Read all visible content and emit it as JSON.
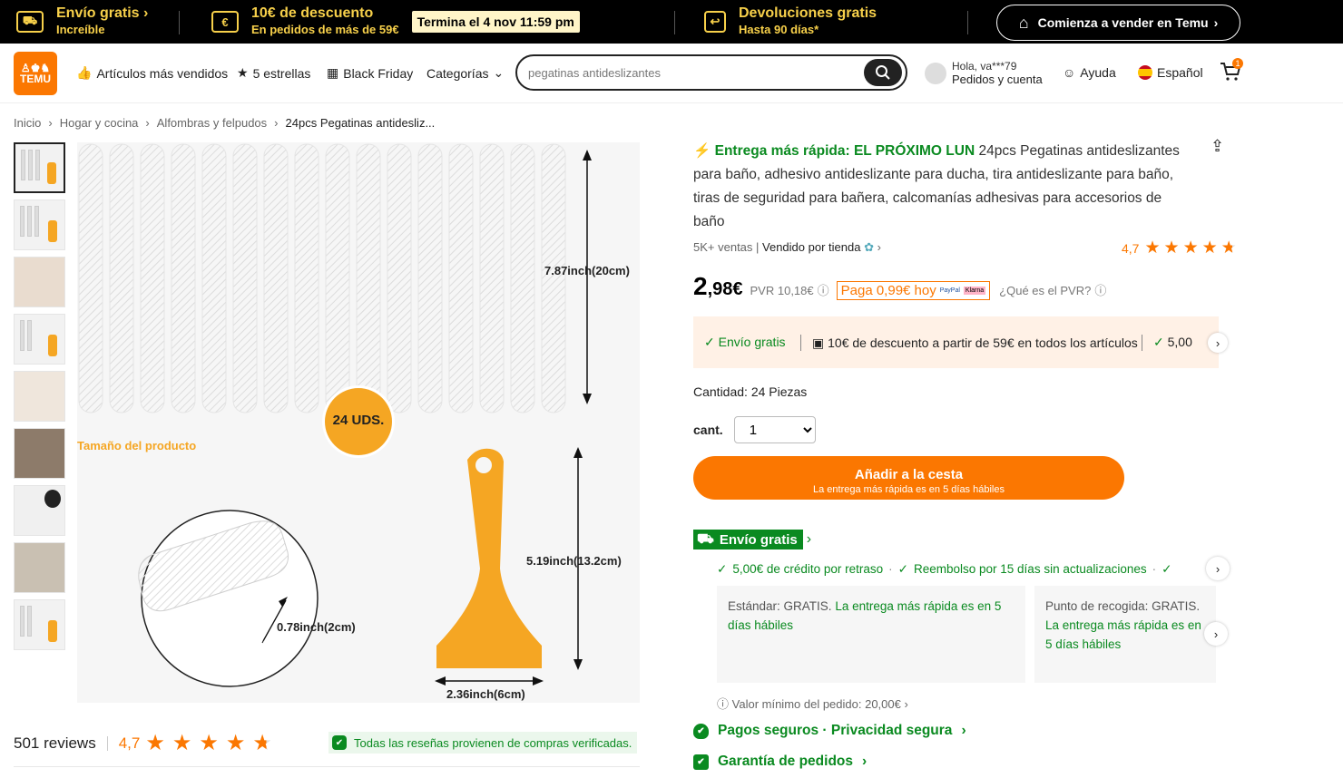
{
  "topbar": {
    "free_shipping_title": "Envío gratis",
    "free_shipping_sub": "Increíble",
    "discount_title": "10€ de descuento",
    "discount_sub": "En pedidos de más de 59€",
    "timer": "Termina el 4 nov 11:59 pm",
    "returns_title": "Devoluciones gratis",
    "returns_sub": "Hasta 90 días*",
    "sell_label": "Comienza a vender en Temu"
  },
  "nav": {
    "logo": "TEMU",
    "links": [
      "Artículos más vendidos",
      "5 estrellas",
      "Black Friday",
      "Categorías"
    ],
    "search_value": "pegatinas antideslizantes",
    "greeting": "Hola, va***79",
    "account": "Pedidos y cuenta",
    "help": "Ayuda",
    "language": "Español",
    "cart_count": "1"
  },
  "breadcrumb": [
    "Inicio",
    "Hogar y cocina",
    "Alfombras y felpudos",
    "24pcs Pegatinas antidesliz..."
  ],
  "image": {
    "dim_strip": "7.87inch(20cm)",
    "dim_handle": "5.19inch(13.2cm)",
    "dim_width": "2.36inch(6cm)",
    "dim_circle": "0.78inch(2cm)",
    "count_badge": "24 UDS.",
    "size_label": "Tamaño del producto"
  },
  "reviews": {
    "count": "501 reviews",
    "rating": "4,7",
    "verified": "Todas las reseñas provienen de compras verificadas."
  },
  "product": {
    "fast_delivery": "Entrega más rápida: EL PRÓXIMO LUN",
    "title": "24pcs Pegatinas antideslizantes para baño, adhesivo antideslizante para ducha, tira antideslizante para baño, tiras de seguridad para bañera, calcomanías adhesivas para accesorios de baño",
    "sales": "5K+ ventas",
    "sold_by": "Vendido por tienda",
    "rating": "4,7",
    "price_int": "2",
    "price_dec": ",98€",
    "pvr": "PVR 10,18€",
    "pay_today": "Paga 0,99€ hoy",
    "pay_brand_1": "PayPal",
    "pay_brand_2": "Klarna",
    "que_pvr": "¿Qué es el PVR?",
    "promo_free": "Envío gratis",
    "promo_discount": "10€ de descuento a partir de 59€ en todos los artículos",
    "promo_credit": "5,00",
    "quantity_label": "Cantidad: 24 Piezas",
    "cant_label": "cant.",
    "qty_value": "1",
    "add_cart": "Añadir a la cesta",
    "add_cart_sub": "La entrega más rápida es en 5 días hábiles",
    "envio_badge": "Envío gratis",
    "guarantees": [
      "5,00€ de crédito por retraso",
      "Reembolso por 15 días sin actualizaciones"
    ],
    "ship_standard_label": "Estándar: GRATIS.",
    "ship_standard_green": "La entrega más rápida es en 5 días hábiles",
    "ship_pickup_label": "Punto de recogida: GRATIS.",
    "ship_pickup_green": "La entrega más rápida es en 5 días hábiles",
    "min_order": "Valor mínimo del pedido: 20,00€",
    "secure": "Pagos seguros · Privacidad segura",
    "order_guarantee": "Garantía de pedidos"
  },
  "colors": {
    "brand": "#fb7701",
    "green": "#0a8a20",
    "accent_yellow": "#f7d04a"
  }
}
